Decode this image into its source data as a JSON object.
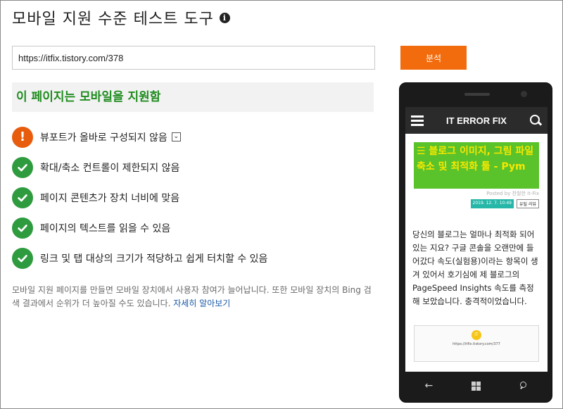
{
  "header": {
    "title": "모바일 지원 수준 테스트 도구",
    "info_icon": "info-icon"
  },
  "form": {
    "url_value": "https://itfix.tistory.com/378",
    "analyze_label": "분석"
  },
  "result": {
    "banner": "이 페이지는 모바일을 지원함",
    "checks": [
      {
        "label": "뷰포트가 올바로 구성되지 않음",
        "status": "warning"
      },
      {
        "label": "확대/축소 컨트롤이 제한되지 않음",
        "status": "pass"
      },
      {
        "label": "페이지 콘텐츠가 장치 너비에 맞음",
        "status": "pass"
      },
      {
        "label": "페이지의 텍스트를 읽을 수 있음",
        "status": "pass"
      },
      {
        "label": "링크 및 탭 대상의 크기가 적당하고 쉽게 터치할 수 있음",
        "status": "pass"
      }
    ],
    "expand_glyph": "⌄"
  },
  "footer": {
    "text": "모바일 지원 페이지를 만들면 모바일 장치에서 사용자 참여가 늘어납니다. 또한 모바일 장치의 Bing 검색 결과에서 순위가 더 높아질 수도 있습니다. ",
    "link": "자세히 알아보기"
  },
  "phone_preview": {
    "blog_title": "IT ERROR FIX",
    "post_title": "☰ 블로그 이미지, 그림 파일 축소 및 최적화 툴 - Pym",
    "byline": "Posted by 찬철한 it-Fix",
    "date": "2019. 12. 7. 10:49",
    "category": "유틸 리뷰",
    "body": "당신의 블로그는 얼마나 최적화 되어 있는 지요? 구글 콘솔을 오랜만에 들어갔다 속도(실험용)이라는 항목이 생겨 있어서 호기심에 제 블로그의 PageSpeed Insights 속도를 측정해 보았습니다. 충격적이었습니다.",
    "thumb_url": "https://itfix.tistory.com/377"
  },
  "colors": {
    "accent": "#f26c0d",
    "success": "#2e9b3f",
    "warning": "#e85c0d",
    "banner_text": "#1f8c1f"
  }
}
